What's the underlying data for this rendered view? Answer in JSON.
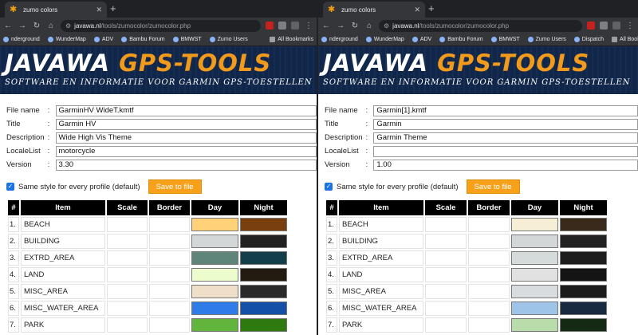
{
  "windows": [
    {
      "tab_title": "zumo colors",
      "url_host": "javawa.nl",
      "url_path": "/tools/zumocolor/zumocolor.php",
      "bookmarks": [
        "nderground",
        "WunderMap",
        "ADV",
        "Bambu Forum",
        "BMWST",
        "Zumo Users"
      ],
      "bookmarks_end": "All Bookmarks",
      "banner_title_left": "JAVAWA",
      "banner_title_right": "GPS-TOOLS",
      "banner_subtitle": "SOFTWARE EN INFORMATIE VOOR GARMIN GPS-TOESTELLEN",
      "form": [
        {
          "label": "File name",
          "value": "GarminHV WideT.kmtf"
        },
        {
          "label": "Title",
          "value": "Garmin HV"
        },
        {
          "label": "Description",
          "value": "Wide High Vis Theme"
        },
        {
          "label": "LocaleList",
          "value": "motorcycle"
        },
        {
          "label": "Version",
          "value": "3.30"
        }
      ],
      "same_style_label": "Same style for every profile (default)",
      "same_style_checked": true,
      "save_label": "Save to file",
      "table_headers": [
        "#",
        "Item",
        "Scale",
        "Border",
        "Day",
        "Night"
      ],
      "rows": [
        {
          "num": "1.",
          "item": "BEACH",
          "day": "#ffd27a",
          "night": "#7a3f0e"
        },
        {
          "num": "2.",
          "item": "BUILDING",
          "day": "#d4d7d8",
          "night": "#222222"
        },
        {
          "num": "3.",
          "item": "EXTRD_AREA",
          "day": "#5f8479",
          "night": "#123f4a"
        },
        {
          "num": "4.",
          "item": "LAND",
          "day": "#ecfccc",
          "night": "#231b10"
        },
        {
          "num": "5.",
          "item": "MISC_AREA",
          "day": "#efdfc8",
          "night": "#2a2a2a"
        },
        {
          "num": "6.",
          "item": "MISC_WATER_AREA",
          "day": "#2f7be8",
          "night": "#1450a8"
        },
        {
          "num": "7.",
          "item": "PARK",
          "day": "#62b53c",
          "night": "#2e7a0e"
        }
      ]
    },
    {
      "tab_title": "zumo colors",
      "url_host": "javawa.nl",
      "url_path": "/tools/zumocolor/zumocolor.php",
      "bookmarks": [
        "nderground",
        "WunderMap",
        "ADV",
        "Bambu Forum",
        "BMWST",
        "Zumo Users",
        "Dispatch"
      ],
      "bookmarks_end": "All Bookmarks",
      "banner_title_left": "JAVAWA",
      "banner_title_right": "GPS-TOOLS",
      "banner_subtitle": "SOFTWARE EN INFORMATIE VOOR GARMIN GPS-TOESTELLEN",
      "form": [
        {
          "label": "File name",
          "value": "Garmin[1].kmtf"
        },
        {
          "label": "Title",
          "value": "Garmin"
        },
        {
          "label": "Description",
          "value": "Garmin Theme"
        },
        {
          "label": "LocaleList",
          "value": ""
        },
        {
          "label": "Version",
          "value": "1.00"
        }
      ],
      "same_style_label": "Same style for every profile (default)",
      "same_style_checked": true,
      "save_label": "Save to file",
      "table_headers": [
        "#",
        "Item",
        "Scale",
        "Border",
        "Day",
        "Night"
      ],
      "rows": [
        {
          "num": "1.",
          "item": "BEACH",
          "day": "#f7eed6",
          "night": "#3a2a1c"
        },
        {
          "num": "2.",
          "item": "BUILDING",
          "day": "#d4d7d8",
          "night": "#222222"
        },
        {
          "num": "3.",
          "item": "EXTRD_AREA",
          "day": "#d5dadb",
          "night": "#1e1e1e"
        },
        {
          "num": "4.",
          "item": "LAND",
          "day": "#e1e1e1",
          "night": "#141414"
        },
        {
          "num": "5.",
          "item": "MISC_AREA",
          "day": "#d9dcde",
          "night": "#1c1c1c"
        },
        {
          "num": "6.",
          "item": "MISC_WATER_AREA",
          "day": "#9ec5e8",
          "night": "#172a40"
        },
        {
          "num": "7.",
          "item": "PARK",
          "day": "#b8dcaa",
          "night": "#152a12"
        }
      ]
    }
  ]
}
